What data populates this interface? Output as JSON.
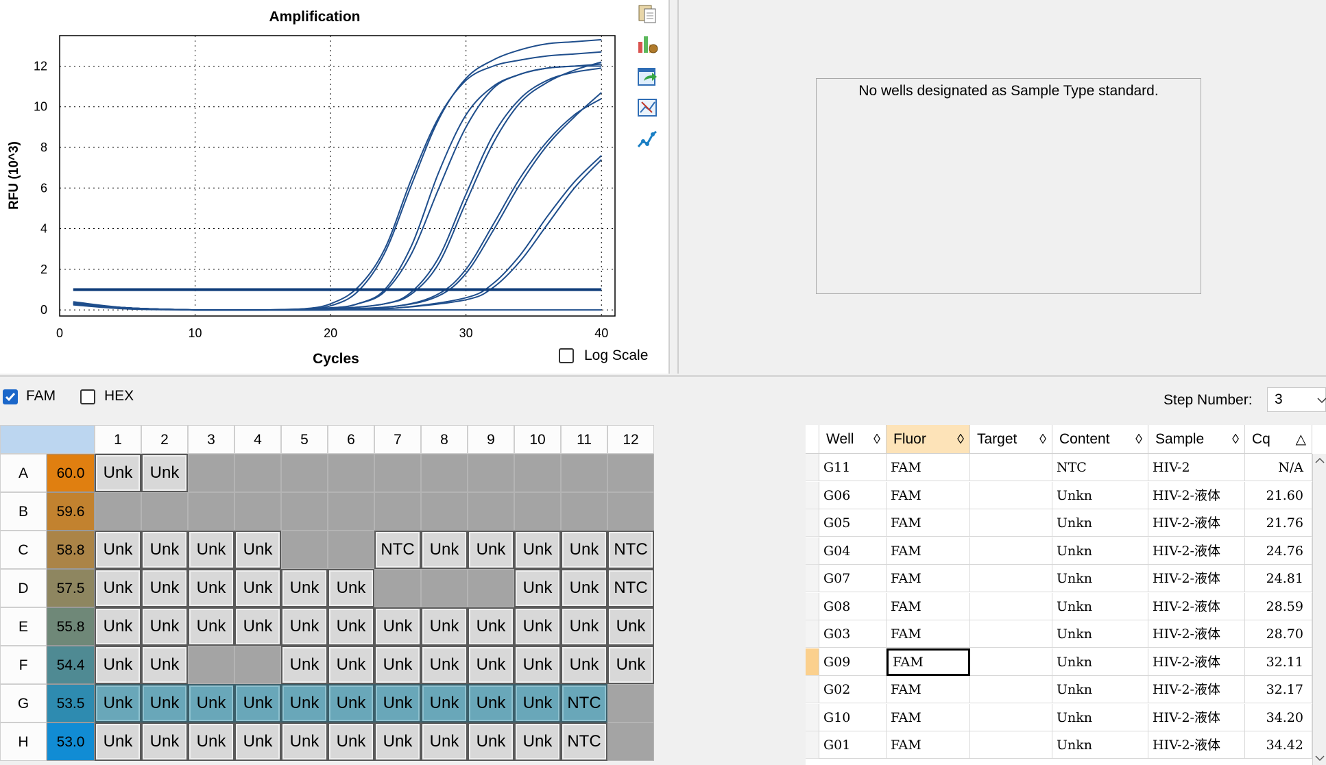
{
  "chart_pane": {
    "title": "Amplification",
    "log_scale_label": "Log Scale",
    "log_scale_checked": false,
    "toolbar_icons": [
      "copy-icon",
      "chart-settings-icon",
      "export-icon",
      "zoom-icon",
      "graph-options-icon"
    ]
  },
  "chart_data": {
    "type": "line",
    "title": "Amplification",
    "xlabel": "Cycles",
    "ylabel": "RFU (10^3)",
    "xlim": [
      0,
      41
    ],
    "ylim": [
      -0.3,
      13.5
    ],
    "xticks": [
      0,
      10,
      20,
      30,
      40
    ],
    "yticks": [
      0,
      2,
      4,
      6,
      8,
      10,
      12
    ],
    "grid": true,
    "threshold": 1.0,
    "series": [
      {
        "well": "G06",
        "x": [
          1,
          5,
          10,
          15,
          18,
          20,
          22,
          24,
          26,
          28,
          30,
          32,
          34,
          36,
          38,
          40
        ],
        "values": [
          0.4,
          0.1,
          0,
          0,
          0.05,
          0.3,
          1.1,
          3.0,
          6.5,
          9.5,
          11.3,
          12.0,
          12.3,
          12.5,
          12.6,
          12.7
        ]
      },
      {
        "well": "G05",
        "x": [
          1,
          5,
          10,
          15,
          18,
          20,
          22,
          24,
          26,
          28,
          30,
          32,
          34,
          36,
          38,
          40
        ],
        "values": [
          0.35,
          0.1,
          0,
          0,
          0.05,
          0.2,
          0.9,
          2.8,
          6.2,
          9.4,
          11.4,
          12.3,
          12.8,
          13.1,
          13.2,
          13.3
        ]
      },
      {
        "well": "G04",
        "x": [
          1,
          5,
          10,
          15,
          20,
          22,
          24,
          26,
          28,
          30,
          32,
          34,
          36,
          38,
          40
        ],
        "values": [
          0.35,
          0.1,
          0,
          0,
          0.1,
          0.3,
          1.0,
          3.2,
          6.8,
          9.6,
          11.0,
          11.6,
          11.9,
          12.0,
          12.1
        ]
      },
      {
        "well": "G07",
        "x": [
          1,
          5,
          10,
          15,
          20,
          22,
          24,
          26,
          28,
          30,
          32,
          34,
          36,
          38,
          40
        ],
        "values": [
          0.35,
          0.1,
          0,
          0,
          0.1,
          0.3,
          0.9,
          2.8,
          6.0,
          9.0,
          10.9,
          11.6,
          11.9,
          12.0,
          12.0
        ]
      },
      {
        "well": "G08",
        "x": [
          1,
          5,
          10,
          15,
          20,
          24,
          26,
          28,
          30,
          32,
          34,
          36,
          38,
          40
        ],
        "values": [
          0.3,
          0.1,
          0,
          0,
          0.05,
          0.3,
          0.9,
          2.6,
          5.7,
          8.6,
          10.4,
          11.3,
          11.7,
          11.9
        ]
      },
      {
        "well": "G03",
        "x": [
          1,
          5,
          10,
          15,
          20,
          24,
          26,
          28,
          30,
          32,
          34,
          36,
          38,
          40
        ],
        "values": [
          0.3,
          0.1,
          0,
          0,
          0.05,
          0.3,
          0.8,
          2.3,
          5.3,
          8.2,
          10.2,
          11.2,
          11.8,
          12.2
        ]
      },
      {
        "well": "G09",
        "x": [
          1,
          5,
          10,
          15,
          20,
          25,
          28,
          30,
          32,
          34,
          36,
          38,
          40
        ],
        "values": [
          0.3,
          0.1,
          0,
          0,
          0.02,
          0.2,
          0.8,
          2.0,
          4.2,
          6.5,
          8.3,
          9.6,
          10.4
        ]
      },
      {
        "well": "G02",
        "x": [
          1,
          5,
          10,
          15,
          20,
          25,
          28,
          30,
          32,
          34,
          36,
          38,
          40
        ],
        "values": [
          0.3,
          0.1,
          0,
          0,
          0.02,
          0.2,
          0.7,
          1.8,
          3.9,
          6.2,
          8.1,
          9.5,
          10.7
        ]
      },
      {
        "well": "G10",
        "x": [
          1,
          5,
          10,
          15,
          20,
          25,
          30,
          32,
          34,
          36,
          38,
          40
        ],
        "values": [
          0.3,
          0.1,
          0,
          0,
          0,
          0.1,
          0.6,
          1.3,
          2.7,
          4.6,
          6.3,
          7.6
        ]
      },
      {
        "well": "G01",
        "x": [
          1,
          5,
          10,
          15,
          20,
          25,
          30,
          32,
          34,
          36,
          38,
          40
        ],
        "values": [
          0.3,
          0.1,
          0,
          0,
          0,
          0.1,
          0.5,
          1.1,
          2.4,
          4.2,
          6.0,
          7.4
        ]
      },
      {
        "well": "G11",
        "x": [
          1,
          5,
          10,
          20,
          30,
          40
        ],
        "values": [
          0.25,
          0.05,
          0,
          0,
          0,
          0
        ]
      }
    ]
  },
  "standard_panel": {
    "message": "No wells designated as Sample Type standard."
  },
  "fluor_bar": {
    "fam_label": "FAM",
    "fam_checked": true,
    "hex_label": "HEX",
    "hex_checked": false,
    "step_label": "Step Number:",
    "step_value": "3"
  },
  "plate": {
    "columns": [
      "1",
      "2",
      "3",
      "4",
      "5",
      "6",
      "7",
      "8",
      "9",
      "10",
      "11",
      "12"
    ],
    "rows": [
      {
        "label": "A",
        "temp": "60.0",
        "temp_color": "#e07f10",
        "wells": [
          "Unk",
          "Unk",
          "",
          "",
          "",
          "",
          "",
          "",
          "",
          "",
          "",
          ""
        ],
        "selected": false
      },
      {
        "label": "B",
        "temp": "59.6",
        "temp_color": "#c2822f",
        "wells": [
          "",
          "",
          "",
          "",
          "",
          "",
          "",
          "",
          "",
          "",
          "",
          ""
        ],
        "selected": false
      },
      {
        "label": "C",
        "temp": "58.8",
        "temp_color": "#ab8447",
        "wells": [
          "Unk",
          "Unk",
          "Unk",
          "Unk",
          "",
          "",
          "NTC",
          "Unk",
          "Unk",
          "Unk",
          "Unk",
          "NTC"
        ],
        "selected": false
      },
      {
        "label": "D",
        "temp": "57.5",
        "temp_color": "#8e8660",
        "wells": [
          "Unk",
          "Unk",
          "Unk",
          "Unk",
          "Unk",
          "Unk",
          "",
          "",
          "",
          "Unk",
          "Unk",
          "NTC"
        ],
        "selected": false
      },
      {
        "label": "E",
        "temp": "55.8",
        "temp_color": "#6f8878",
        "wells": [
          "Unk",
          "Unk",
          "Unk",
          "Unk",
          "Unk",
          "Unk",
          "Unk",
          "Unk",
          "Unk",
          "Unk",
          "Unk",
          "Unk"
        ],
        "selected": false
      },
      {
        "label": "F",
        "temp": "54.4",
        "temp_color": "#4f8a93",
        "wells": [
          "Unk",
          "Unk",
          "",
          "",
          "Unk",
          "Unk",
          "Unk",
          "Unk",
          "Unk",
          "Unk",
          "Unk",
          "Unk"
        ],
        "selected": false
      },
      {
        "label": "G",
        "temp": "53.5",
        "temp_color": "#2e8bb0",
        "wells": [
          "Unk",
          "Unk",
          "Unk",
          "Unk",
          "Unk",
          "Unk",
          "Unk",
          "Unk",
          "Unk",
          "Unk",
          "NTC",
          ""
        ],
        "selected": true
      },
      {
        "label": "H",
        "temp": "53.0",
        "temp_color": "#118cd4",
        "wells": [
          "Unk",
          "Unk",
          "Unk",
          "Unk",
          "Unk",
          "Unk",
          "Unk",
          "Unk",
          "Unk",
          "Unk",
          "NTC",
          ""
        ],
        "selected": false
      }
    ]
  },
  "results_table": {
    "headers": [
      "Well",
      "Fluor",
      "Target",
      "Content",
      "Sample",
      "Cq"
    ],
    "active_header": "Fluor",
    "rows": [
      {
        "well": "G11",
        "fluor": "FAM",
        "target": "",
        "content": "NTC",
        "sample": "HIV-2",
        "cq": "N/A"
      },
      {
        "well": "G06",
        "fluor": "FAM",
        "target": "",
        "content": "Unkn",
        "sample": "HIV-2-液体",
        "cq": "21.60"
      },
      {
        "well": "G05",
        "fluor": "FAM",
        "target": "",
        "content": "Unkn",
        "sample": "HIV-2-液体",
        "cq": "21.76"
      },
      {
        "well": "G04",
        "fluor": "FAM",
        "target": "",
        "content": "Unkn",
        "sample": "HIV-2-液体",
        "cq": "24.76"
      },
      {
        "well": "G07",
        "fluor": "FAM",
        "target": "",
        "content": "Unkn",
        "sample": "HIV-2-液体",
        "cq": "24.81"
      },
      {
        "well": "G08",
        "fluor": "FAM",
        "target": "",
        "content": "Unkn",
        "sample": "HIV-2-液体",
        "cq": "28.59"
      },
      {
        "well": "G03",
        "fluor": "FAM",
        "target": "",
        "content": "Unkn",
        "sample": "HIV-2-液体",
        "cq": "28.70"
      },
      {
        "well": "G09",
        "fluor": "FAM",
        "target": "",
        "content": "Unkn",
        "sample": "HIV-2-液体",
        "cq": "32.11"
      },
      {
        "well": "G02",
        "fluor": "FAM",
        "target": "",
        "content": "Unkn",
        "sample": "HIV-2-液体",
        "cq": "32.17"
      },
      {
        "well": "G10",
        "fluor": "FAM",
        "target": "",
        "content": "Unkn",
        "sample": "HIV-2-液体",
        "cq": "34.20"
      },
      {
        "well": "G01",
        "fluor": "FAM",
        "target": "",
        "content": "Unkn",
        "sample": "HIV-2-液体",
        "cq": "34.42"
      }
    ],
    "current_row": 7
  },
  "colors": {
    "curve": "#1f4e8c",
    "threshold": "#0d3b78",
    "selected_well": "#69a7b9",
    "active_header": "#fde3b8"
  }
}
